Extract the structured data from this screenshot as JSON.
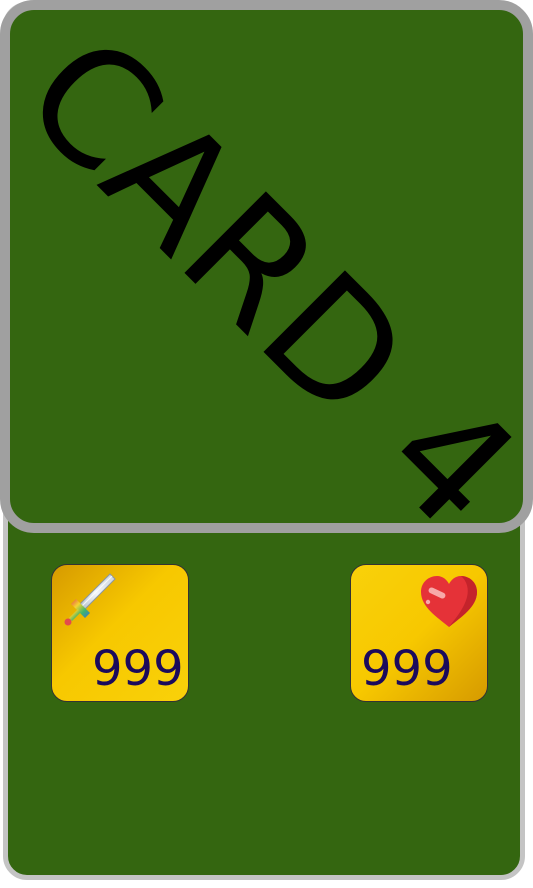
{
  "card": {
    "art_label": "CARD 4",
    "colors": {
      "felt": "#346610",
      "frame_outer": "#c4c4c4",
      "frame_art": "#a0a0a0",
      "badge": "#f7c800",
      "value_text": "#1b0a5c"
    }
  },
  "stats": {
    "attack": {
      "icon": "sword-icon",
      "value": "999"
    },
    "health": {
      "icon": "heart-icon",
      "value": "999"
    }
  }
}
